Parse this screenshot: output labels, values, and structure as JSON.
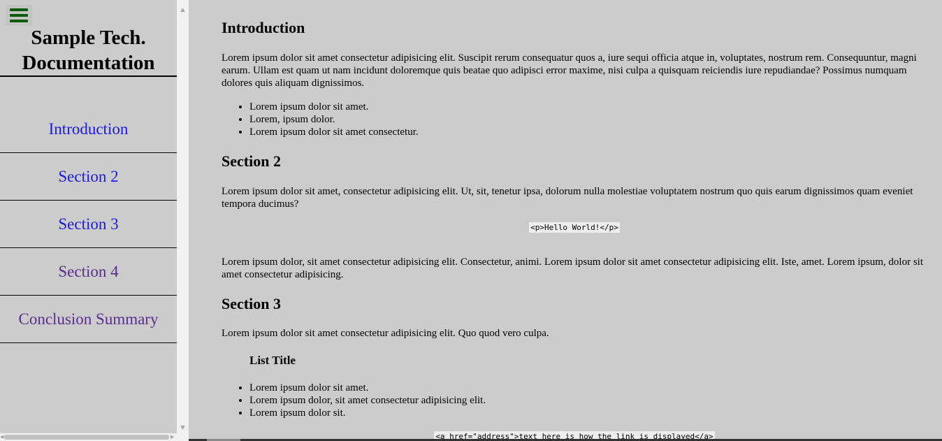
{
  "sidebar": {
    "title_line1": "Sample Tech.",
    "title_line2": "Documentation",
    "nav_items": [
      {
        "label": "Introduction"
      },
      {
        "label": "Section 2"
      },
      {
        "label": "Section 3"
      },
      {
        "label": "Section 4"
      },
      {
        "label": "Conclusion Summary"
      }
    ]
  },
  "main": {
    "intro": {
      "heading": "Introduction",
      "paragraph": "Lorem ipsum dolor sit amet consectetur adipisicing elit. Suscipit rerum consequatur quos a, iure sequi officia atque in, voluptates, nostrum rem. Consequuntur, magni earum. Ullam est quam ut nam incidunt doloremque quis beatae quo adipisci error maxime, nisi culpa a quisquam reiciendis iure repudiandae? Possimus numquam dolores quis aliquam dignissimos.",
      "list": [
        "Lorem ipsum dolor sit amet.",
        "Lorem, ipsum dolor.",
        "Lorem ipsum dolor sit amet consectetur."
      ]
    },
    "section2": {
      "heading": "Section 2",
      "paragraph1": "Lorem ipsum dolor sit amet, consectetur adipisicing elit. Ut, sit, tenetur ipsa, dolorum nulla molestiae voluptatem nostrum quo quis earum dignissimos quam eveniet tempora ducimus?",
      "code": "<p>Hello World!</p>",
      "paragraph2": "Lorem ipsum dolor, sit amet consectetur adipisicing elit. Consectetur, animi. Lorem ipsum dolor sit amet consectetur adipisicing elit. Iste, amet. Lorem ipsum, dolor sit amet consectetur adipisicing."
    },
    "section3": {
      "heading": "Section 3",
      "paragraph": "Lorem ipsum dolor sit amet consectetur adipisicing elit. Quo quod vero culpa.",
      "list_title": "List Title",
      "list": [
        "Lorem ipsum dolor sit amet.",
        "Lorem ipsum dolor, sit amet consectetur adipisicing elit.",
        "Lorem ipsum dolor sit."
      ],
      "code": "<a href=\"address\">text here is how the link is displayed</a>"
    }
  },
  "colors": {
    "background": "#cccccc",
    "menu_icon": "#0b5d0b",
    "link_unvisited": "#1a1ae6",
    "link_visited": "#5b2c8f",
    "code_background": "#eeeeee"
  },
  "icons": {
    "menu": "hamburger-menu-icon"
  }
}
